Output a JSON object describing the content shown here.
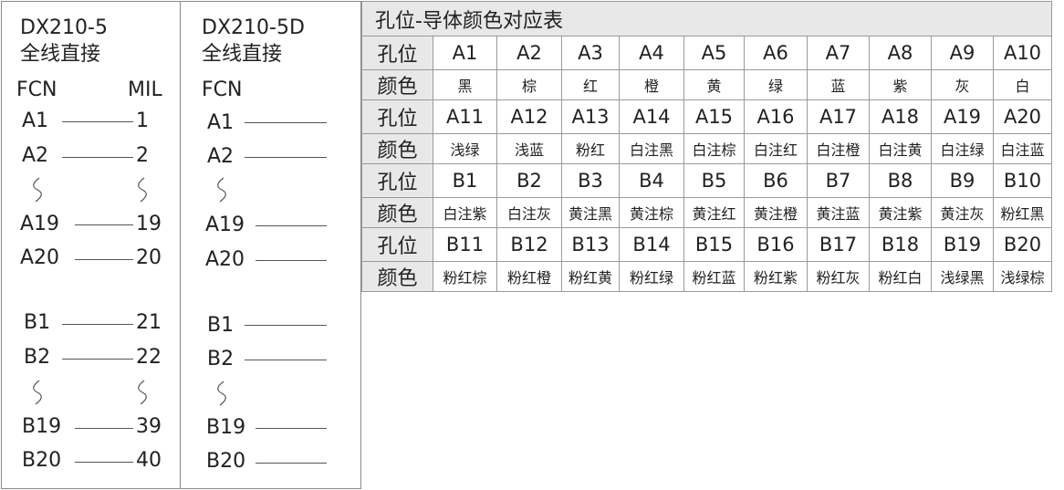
{
  "left_panel": {
    "title_model": "DX210-5",
    "title_desc": "全线直接",
    "header_left": "FCN",
    "header_right": "MIL",
    "rows": [
      {
        "from": "A1",
        "to": "1"
      },
      {
        "from": "A2",
        "to": "2"
      },
      {
        "from": "A19",
        "to": "19"
      },
      {
        "from": "A20",
        "to": "20"
      },
      {
        "from": "B1",
        "to": "21"
      },
      {
        "from": "B2",
        "to": "22"
      },
      {
        "from": "B19",
        "to": "39"
      },
      {
        "from": "B20",
        "to": "40"
      }
    ]
  },
  "mid_panel": {
    "title_model": "DX210-5D",
    "title_desc": "全线直接",
    "header_left": "FCN",
    "rows": [
      {
        "from": "A1"
      },
      {
        "from": "A2"
      },
      {
        "from": "A19"
      },
      {
        "from": "A20"
      },
      {
        "from": "B1"
      },
      {
        "from": "B2"
      },
      {
        "from": "B19"
      },
      {
        "from": "B20"
      }
    ]
  },
  "table": {
    "title": "孔位-导体颜色对应表",
    "pos_label": "孔位",
    "color_label": "颜色",
    "groups": [
      {
        "positions": [
          "A1",
          "A2",
          "A3",
          "A4",
          "A5",
          "A6",
          "A7",
          "A8",
          "A9",
          "A10"
        ],
        "colors": [
          "黑",
          "棕",
          "红",
          "橙",
          "黄",
          "绿",
          "蓝",
          "紫",
          "灰",
          "白"
        ]
      },
      {
        "positions": [
          "A11",
          "A12",
          "A13",
          "A14",
          "A15",
          "A16",
          "A17",
          "A18",
          "A19",
          "A20"
        ],
        "colors": [
          "浅绿",
          "浅蓝",
          "粉红",
          "白注黑",
          "白注棕",
          "白注红",
          "白注橙",
          "白注黄",
          "白注绿",
          "白注蓝"
        ]
      },
      {
        "positions": [
          "B1",
          "B2",
          "B3",
          "B4",
          "B5",
          "B6",
          "B7",
          "B8",
          "B9",
          "B10"
        ],
        "colors": [
          "白注紫",
          "白注灰",
          "黄注黑",
          "黄注棕",
          "黄注红",
          "黄注橙",
          "黄注蓝",
          "黄注紫",
          "黄注灰",
          "粉红黑"
        ]
      },
      {
        "positions": [
          "B11",
          "B12",
          "B13",
          "B14",
          "B15",
          "B16",
          "B17",
          "B18",
          "B19",
          "B20"
        ],
        "colors": [
          "粉红棕",
          "粉红橙",
          "粉红黄",
          "粉红绿",
          "粉红蓝",
          "粉红紫",
          "粉红灰",
          "粉红白",
          "浅绿黑",
          "浅绿棕"
        ]
      }
    ]
  }
}
